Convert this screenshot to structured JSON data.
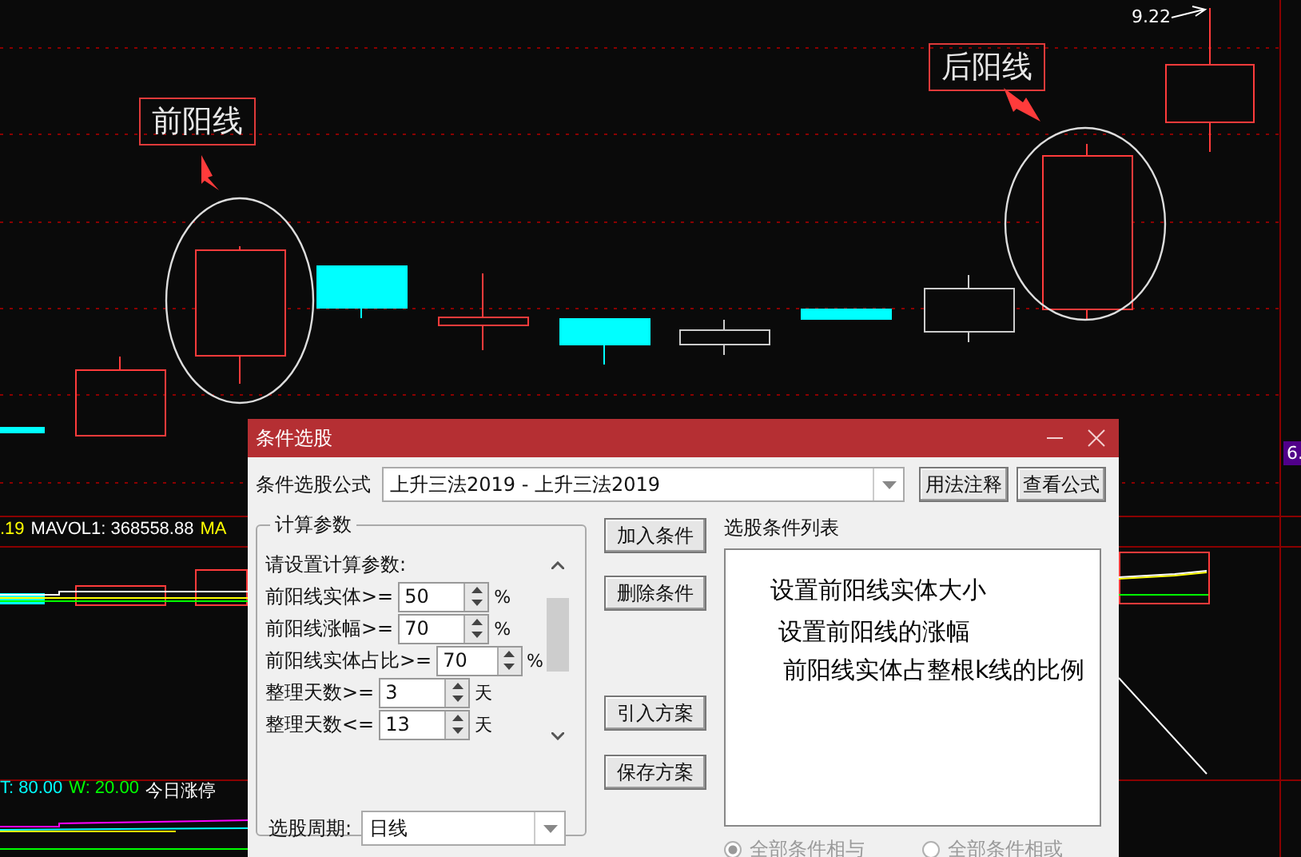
{
  "chart": {
    "price_label": "9.22",
    "axis_label": "6.",
    "annotations": [
      {
        "text": "前阳线"
      },
      {
        "text": "后阳线"
      }
    ],
    "volume_header": [
      {
        "text": ".19",
        "color": "#ffff00"
      },
      {
        "text": "MAVOL1: 368558.88",
        "color": "#ffffff"
      },
      {
        "text": "MA",
        "color": "#ffff00"
      }
    ],
    "indicator_header": [
      {
        "text": "T: 80.00",
        "color": "#00ffff"
      },
      {
        "text": "W: 20.00",
        "color": "#00ff00"
      },
      {
        "text": "今日涨停",
        "color": "#ffffff"
      }
    ]
  },
  "dialog": {
    "title": "条件选股",
    "formula_label": "条件选股公式",
    "formula_value": "上升三法2019 - 上升三法2019",
    "top_buttons": [
      "用法注释",
      "查看公式"
    ],
    "group_title": "计算参数",
    "params_hint": "请设置计算参数:",
    "params": [
      {
        "label": "前阳线实体>=",
        "value": "50",
        "unit": "%"
      },
      {
        "label": "前阳线涨幅>=",
        "value": "70",
        "unit": "%"
      },
      {
        "label": "前阳线实体占比>=",
        "value": "70",
        "unit": "%"
      },
      {
        "label": "整理天数>=",
        "value": "3",
        "unit": "天"
      },
      {
        "label": "整理天数<=",
        "value": "13",
        "unit": "天"
      }
    ],
    "side_buttons": [
      "加入条件",
      "删除条件",
      "引入方案",
      "保存方案"
    ],
    "list_title": "选股条件列表",
    "period_label": "选股周期:",
    "period_value": "日线",
    "logic": [
      {
        "label": "全部条件相与",
        "selected": true
      },
      {
        "label": "全部条件相或",
        "selected": false
      }
    ]
  },
  "callouts": [
    "设置前阳线实体大小",
    "设置前阳线的涨幅",
    "前阳线实体占整根k线的比例"
  ]
}
